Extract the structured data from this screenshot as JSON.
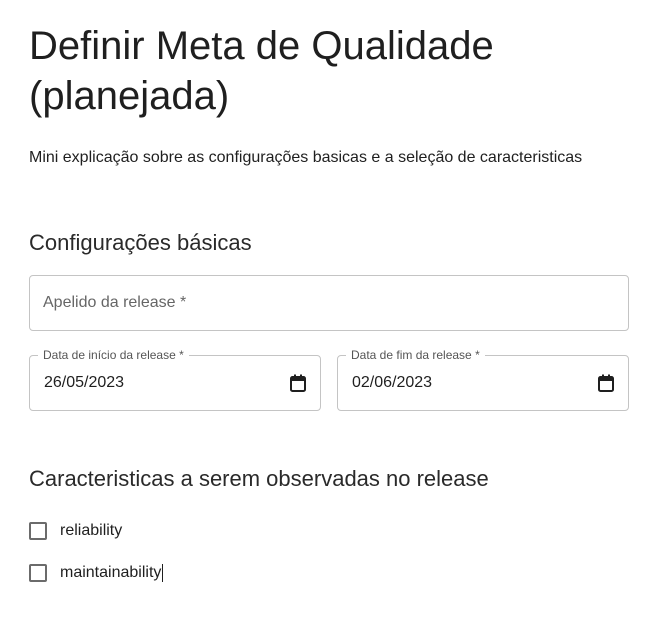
{
  "page": {
    "title": "Definir Meta de Qualidade (planejada)",
    "intro": "Mini explicação sobre as configurações basicas e a seleção de caracteristicas"
  },
  "basic_settings": {
    "heading": "Configurações básicas",
    "release_nickname": {
      "placeholder": "Apelido da release *",
      "value": ""
    },
    "start_date": {
      "label": "Data de início da release *",
      "value": "26/05/2023",
      "icon": "calendar-icon"
    },
    "end_date": {
      "label": "Data de fim da release *",
      "value": "02/06/2023",
      "icon": "calendar-icon"
    }
  },
  "characteristics": {
    "heading": "Caracteristicas a serem observadas no release",
    "options": [
      {
        "label": "reliability",
        "checked": false
      },
      {
        "label": "maintainability",
        "checked": false
      }
    ]
  }
}
